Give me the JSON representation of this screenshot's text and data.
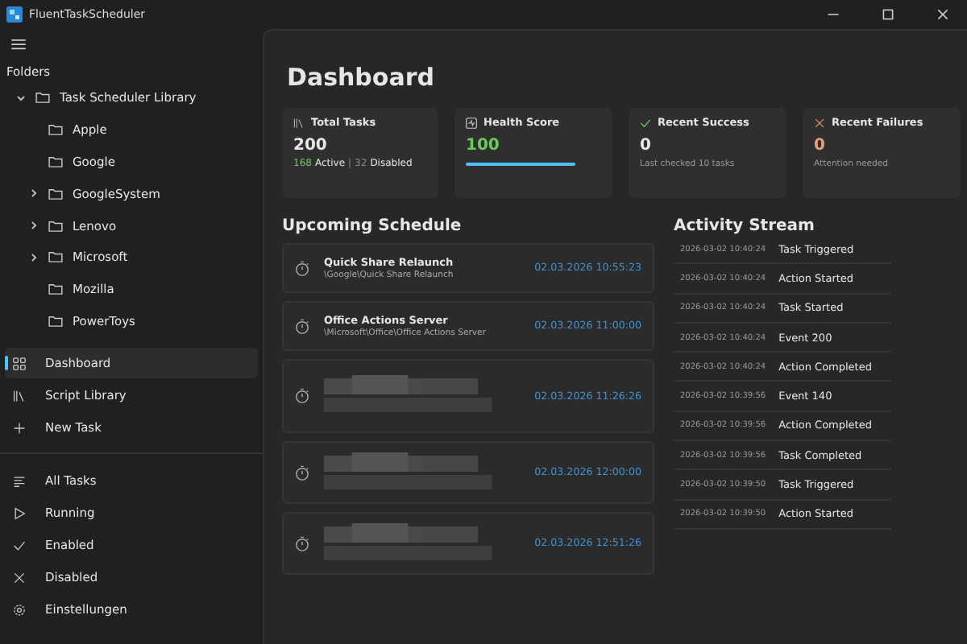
{
  "window": {
    "title": "FluentTaskScheduler"
  },
  "sidebar": {
    "folders_label": "Folders",
    "tree": [
      {
        "label": "Task Scheduler Library",
        "expanded": true,
        "children": [
          {
            "label": "Apple",
            "has_children": false
          },
          {
            "label": "Google",
            "has_children": false
          },
          {
            "label": "GoogleSystem",
            "has_children": true
          },
          {
            "label": "Lenovo",
            "has_children": true
          },
          {
            "label": "Microsoft",
            "has_children": true
          },
          {
            "label": "Mozilla",
            "has_children": false
          },
          {
            "label": "PowerToys",
            "has_children": false
          }
        ]
      }
    ],
    "nav": [
      {
        "label": "Dashboard",
        "selected": true
      },
      {
        "label": "Script Library",
        "selected": false
      },
      {
        "label": "New Task",
        "selected": false
      }
    ],
    "filters": [
      {
        "label": "All Tasks",
        "selected": false
      },
      {
        "label": "Running",
        "selected": false
      },
      {
        "label": "Enabled",
        "selected": false
      },
      {
        "label": "Disabled",
        "selected": false
      },
      {
        "label": "Einstellungen",
        "selected": false
      }
    ]
  },
  "heading": "Dashboard",
  "cards": [
    {
      "kind": "total",
      "title": "Total Tasks",
      "value": "200",
      "active": "168",
      "active_label": "Active",
      "separator": "|",
      "disabled": "32",
      "disabled_label": "Disabled"
    },
    {
      "kind": "health",
      "title": "Health Score",
      "value": "100",
      "level": 1
    },
    {
      "kind": "success",
      "title": "Recent Success",
      "value": "0",
      "note": "Last checked 10 tasks"
    },
    {
      "kind": "failure",
      "title": "Recent Failures",
      "value": "0",
      "note": "Attention needed"
    }
  ],
  "schedule": {
    "title": "Upcoming Schedule",
    "rows": [
      {
        "kind": "task",
        "name": "Quick Share Relaunch",
        "path": "\\Google\\Quick Share Relaunch",
        "time": "02.03.2026 10:55:23"
      },
      {
        "kind": "task",
        "name": "Office Actions Server",
        "path": "\\Microsoft\\Office\\Office Actions Server",
        "time": "02.03.2026 11:00:00"
      },
      {
        "kind": "redacted",
        "time": "02.03.2026 11:26:26"
      },
      {
        "kind": "redacted",
        "time": "02.03.2026 12:00:00"
      },
      {
        "kind": "redacted",
        "time": "02.03.2026 12:51:26"
      }
    ]
  },
  "activity": {
    "title": "Activity Stream",
    "rows": [
      {
        "time": "2026-03-02 10:40:24",
        "event": "Task Triggered"
      },
      {
        "time": "2026-03-02 10:40:24",
        "event": "Action Started"
      },
      {
        "time": "2026-03-02 10:40:24",
        "event": "Task Started"
      },
      {
        "time": "2026-03-02 10:40:24",
        "event": "Event 200"
      },
      {
        "time": "2026-03-02 10:40:24",
        "event": "Action Completed"
      },
      {
        "time": "2026-03-02 10:39:56",
        "event": "Event 140"
      },
      {
        "time": "2026-03-02 10:39:56",
        "event": "Action Completed"
      },
      {
        "time": "2026-03-02 10:39:56",
        "event": "Task Completed"
      },
      {
        "time": "2026-03-02 10:39:50",
        "event": "Task Triggered"
      },
      {
        "time": "2026-03-02 10:39:50",
        "event": "Action Started"
      }
    ]
  }
}
